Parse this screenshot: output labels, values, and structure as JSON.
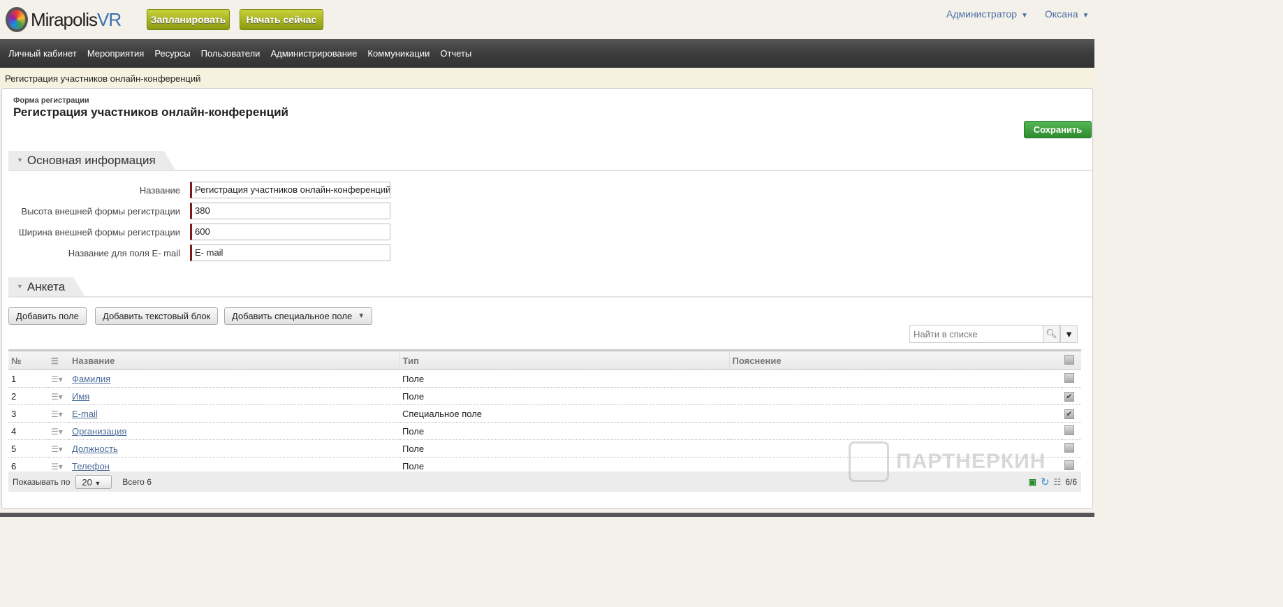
{
  "header": {
    "logo_text": "Mirapolis",
    "logo_suffix": "VR",
    "schedule_label": "Запланировать",
    "start_now_label": "Начать сейчас",
    "role": "Администратор",
    "user": "Оксана"
  },
  "nav": [
    "Личный кабинет",
    "Мероприятия",
    "Ресурсы",
    "Пользователи",
    "Администрирование",
    "Коммуникации",
    "Отчеты"
  ],
  "breadcrumb": "Регистрация участников онлайн-конференций",
  "page": {
    "subtitle": "Форма регистрации",
    "title": "Регистрация участников онлайн-конференций",
    "save_label": "Сохранить"
  },
  "main_info": {
    "section": "Основная информация",
    "fields": [
      {
        "label": "Название",
        "value": "Регистрация участников  онлайн-конференций"
      },
      {
        "label": "Высота внешней формы регистрации",
        "value": "380"
      },
      {
        "label": "Ширина внешней формы регистрации",
        "value": "600"
      },
      {
        "label": "Название для поля E- mail",
        "value": "E- mail"
      }
    ]
  },
  "survey": {
    "section": "Анкета",
    "add_field": "Добавить поле",
    "add_text_block": "Добавить текстовый блок",
    "add_special": "Добавить специальное поле",
    "search_placeholder": "Найти в списке",
    "columns": {
      "num": "№",
      "name": "Название",
      "type": "Тип",
      "note": "Пояснение"
    },
    "rows": [
      {
        "n": "1",
        "name": "Фамилия",
        "type": "Поле",
        "checked": false
      },
      {
        "n": "2",
        "name": "Имя",
        "type": "Поле",
        "checked": true
      },
      {
        "n": "3",
        "name": "E-mail",
        "type": "Специальное поле",
        "checked": true
      },
      {
        "n": "4",
        "name": "Организация",
        "type": "Поле",
        "checked": false
      },
      {
        "n": "5",
        "name": "Должность",
        "type": "Поле",
        "checked": false
      },
      {
        "n": "6",
        "name": "Телефон",
        "type": "Поле",
        "checked": false
      }
    ],
    "footer": {
      "show_label": "Показывать по",
      "page_size": "20",
      "total": "Всего 6",
      "count": "6/6"
    }
  },
  "watermark": "ПАРТНЕРКИН"
}
